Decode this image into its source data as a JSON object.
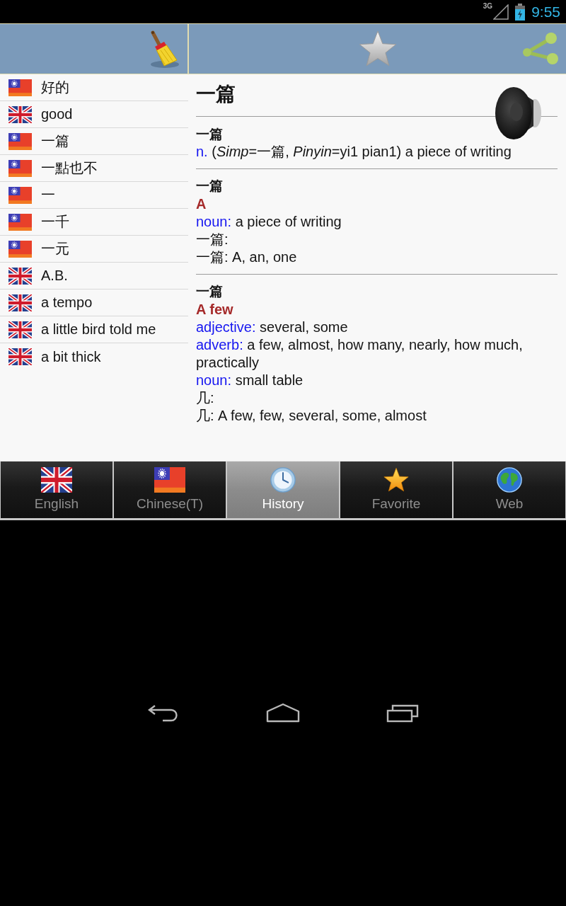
{
  "status_bar": {
    "network": "3G",
    "time": "9:55"
  },
  "history": [
    {
      "text": "好的",
      "kind": "chinese"
    },
    {
      "text": "good",
      "kind": "english"
    },
    {
      "text": "一篇",
      "kind": "chinese"
    },
    {
      "text": "一點也不",
      "kind": "chinese"
    },
    {
      "text": "一",
      "kind": "chinese"
    },
    {
      "text": "一千",
      "kind": "chinese"
    },
    {
      "text": "一元",
      "kind": "chinese"
    },
    {
      "text": "A.B.",
      "kind": "english"
    },
    {
      "text": "a tempo",
      "kind": "english"
    },
    {
      "text": "a little bird told me",
      "kind": "english"
    },
    {
      "text": "a bit thick",
      "kind": "english"
    }
  ],
  "entry": {
    "headword": "一篇",
    "blocks": [
      {
        "heading": "一篇",
        "lines": [
          {
            "kind": "pos",
            "pos": "n.",
            "text": "(*Simp*=一篇, *Pinyin*=yi1 pian1) a piece of writing"
          }
        ]
      },
      {
        "heading": "一篇",
        "sense": "A",
        "lines": [
          {
            "kind": "pos",
            "pos": "noun:",
            "text": "a piece of writing"
          },
          {
            "kind": "plain",
            "text": "一篇:"
          },
          {
            "kind": "plain",
            "text": "一篇: A, an, one"
          }
        ]
      },
      {
        "heading": "一篇",
        "sense": "A few",
        "lines": [
          {
            "kind": "pos",
            "pos": "adjective:",
            "text": "several, some"
          },
          {
            "kind": "pos",
            "pos": "adverb:",
            "text": "a few, almost, how many, nearly, how much, practically"
          },
          {
            "kind": "pos",
            "pos": "noun:",
            "text": "small table"
          },
          {
            "kind": "plain",
            "text": "几:"
          },
          {
            "kind": "plain",
            "text": "几: A few, few, several, some, almost"
          }
        ]
      }
    ]
  },
  "tabs": [
    {
      "label": "English",
      "selected": false
    },
    {
      "label": "Chinese(T)",
      "selected": false
    },
    {
      "label": "History",
      "selected": true
    },
    {
      "label": "Favorite",
      "selected": false
    },
    {
      "label": "Web",
      "selected": false
    }
  ]
}
